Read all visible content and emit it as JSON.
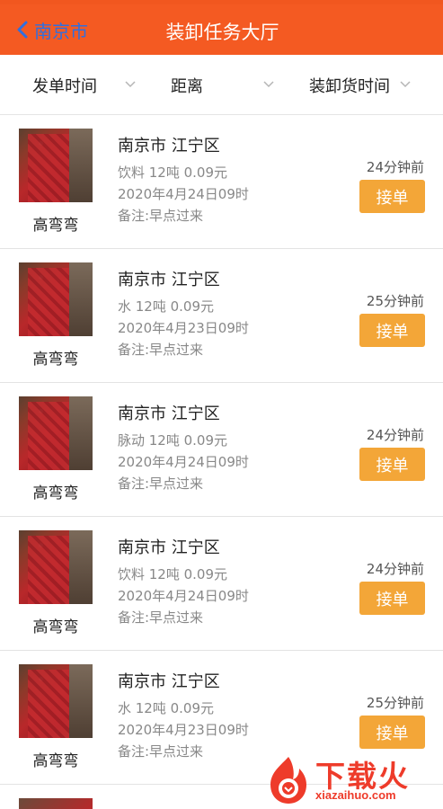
{
  "header": {
    "back_label": "南京市",
    "title": "装卸任务大厅"
  },
  "filters": [
    {
      "label": "发单时间"
    },
    {
      "label": "距离"
    },
    {
      "label": "装卸货时间"
    }
  ],
  "tasks": [
    {
      "name": "高弯弯",
      "location": "南京市 江宁区",
      "cargo": "饮料 12吨 0.09元",
      "time": "2020年4月24日09时",
      "note": "备注:早点过来",
      "ago": "24分钟前",
      "action": "接单"
    },
    {
      "name": "高弯弯",
      "location": "南京市 江宁区",
      "cargo": "水 12吨 0.09元",
      "time": "2020年4月23日09时",
      "note": "备注:早点过来",
      "ago": "25分钟前",
      "action": "接单"
    },
    {
      "name": "高弯弯",
      "location": "南京市 江宁区",
      "cargo": "脉动 12吨 0.09元",
      "time": "2020年4月24日09时",
      "note": "备注:早点过来",
      "ago": "24分钟前",
      "action": "接单"
    },
    {
      "name": "高弯弯",
      "location": "南京市 江宁区",
      "cargo": "饮料 12吨 0.09元",
      "time": "2020年4月24日09时",
      "note": "备注:早点过来",
      "ago": "24分钟前",
      "action": "接单"
    },
    {
      "name": "高弯弯",
      "location": "南京市 江宁区",
      "cargo": "水 12吨 0.09元",
      "time": "2020年4月23日09时",
      "note": "备注:早点过来",
      "ago": "25分钟前",
      "action": "接单"
    }
  ],
  "watermark": {
    "brand": "下载火",
    "url": "xiazaihuo.com"
  },
  "colors": {
    "header_bg": "#f45a22",
    "back_text": "#2f6fe0",
    "accept_button": "#f3a638",
    "watermark": "#ee3b2a"
  }
}
